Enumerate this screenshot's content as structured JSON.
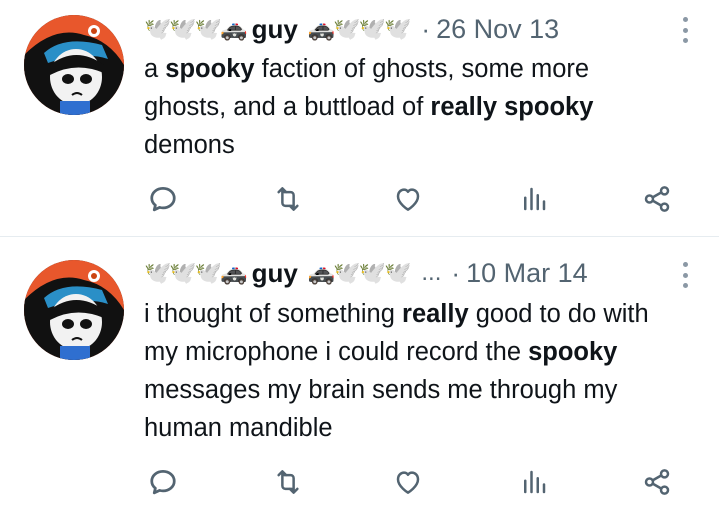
{
  "tweets": [
    {
      "display_name": "guy",
      "emoji_before": "🕊️🕊️🕊️🚓",
      "emoji_after": "🚓🕊️🕊️🕊️",
      "truncated": "",
      "separator": "·",
      "date": "26 Nov 13",
      "text_parts": [
        "a ",
        "spooky",
        " faction of ghosts, some more ghosts, and a buttload of ",
        "really spooky",
        " demons"
      ]
    },
    {
      "display_name": "guy",
      "emoji_before": "🕊️🕊️🕊️🚓",
      "emoji_after": "🚓🕊️🕊️🕊️",
      "truncated": "...",
      "separator": "·",
      "date": "10 Mar 14",
      "text_parts": [
        "i thought of something ",
        "really",
        " good to do with my microphone i could record the ",
        "spooky",
        " messages my brain sends me through my human mandible"
      ]
    }
  ],
  "icons": {
    "reply": "speech-bubble-icon",
    "retweet": "retweet-icon",
    "like": "heart-icon",
    "views": "bar-chart-icon",
    "share": "share-nodes-icon",
    "more": "more-vertical-icon"
  },
  "colors": {
    "text": "#0f1419",
    "secondary": "#536471",
    "divider": "#e6ecf0",
    "icon": "#536471"
  }
}
